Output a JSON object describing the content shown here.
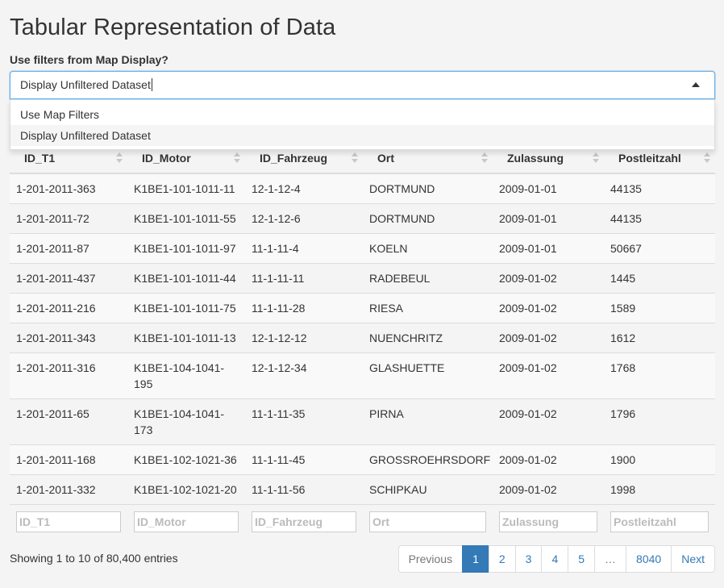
{
  "page": {
    "title": "Tabular Representation of Data",
    "filter_label": "Use filters from Map Display?"
  },
  "select": {
    "value": "Display Unfiltered Dataset",
    "options": [
      "Use Map Filters",
      "Display Unfiltered Dataset"
    ],
    "selected_index": 1
  },
  "table": {
    "columns": [
      "ID_T1",
      "ID_Motor",
      "ID_Fahrzeug",
      "Ort",
      "Zulassung",
      "Postleitzahl"
    ],
    "rows": [
      [
        "1-201-2011-363",
        "K1BE1-101-1011-11",
        "12-1-12-4",
        "DORTMUND",
        "2009-01-01",
        "44135"
      ],
      [
        "1-201-2011-72",
        "K1BE1-101-1011-55",
        "12-1-12-6",
        "DORTMUND",
        "2009-01-01",
        "44135"
      ],
      [
        "1-201-2011-87",
        "K1BE1-101-1011-97",
        "11-1-11-4",
        "KOELN",
        "2009-01-01",
        "50667"
      ],
      [
        "1-201-2011-437",
        "K1BE1-101-1011-44",
        "11-1-11-11",
        "RADEBEUL",
        "2009-01-02",
        "1445"
      ],
      [
        "1-201-2011-216",
        "K1BE1-101-1011-75",
        "11-1-11-28",
        "RIESA",
        "2009-01-02",
        "1589"
      ],
      [
        "1-201-2011-343",
        "K1BE1-101-1011-13",
        "12-1-12-12",
        "NUENCHRITZ",
        "2009-01-02",
        "1612"
      ],
      [
        "1-201-2011-316",
        "K1BE1-104-1041-195",
        "12-1-12-34",
        "GLASHUETTE",
        "2009-01-02",
        "1768"
      ],
      [
        "1-201-2011-65",
        "K1BE1-104-1041-173",
        "11-1-11-35",
        "PIRNA",
        "2009-01-02",
        "1796"
      ],
      [
        "1-201-2011-168",
        "K1BE1-102-1021-36",
        "11-1-11-45",
        "GROSSROEHRSDORF",
        "2009-01-02",
        "1900"
      ],
      [
        "1-201-2011-332",
        "K1BE1-102-1021-20",
        "11-1-11-56",
        "SCHIPKAU",
        "2009-01-02",
        "1998"
      ]
    ],
    "filter_placeholders": [
      "ID_T1",
      "ID_Motor",
      "ID_Fahrzeug",
      "Ort",
      "Zulassung",
      "Postleitzahl"
    ]
  },
  "footer": {
    "info": "Showing 1 to 10 of 80,400 entries",
    "pagination": {
      "previous": "Previous",
      "pages": [
        "1",
        "2",
        "3",
        "4",
        "5",
        "…",
        "8040"
      ],
      "current": "1",
      "next": "Next"
    }
  }
}
